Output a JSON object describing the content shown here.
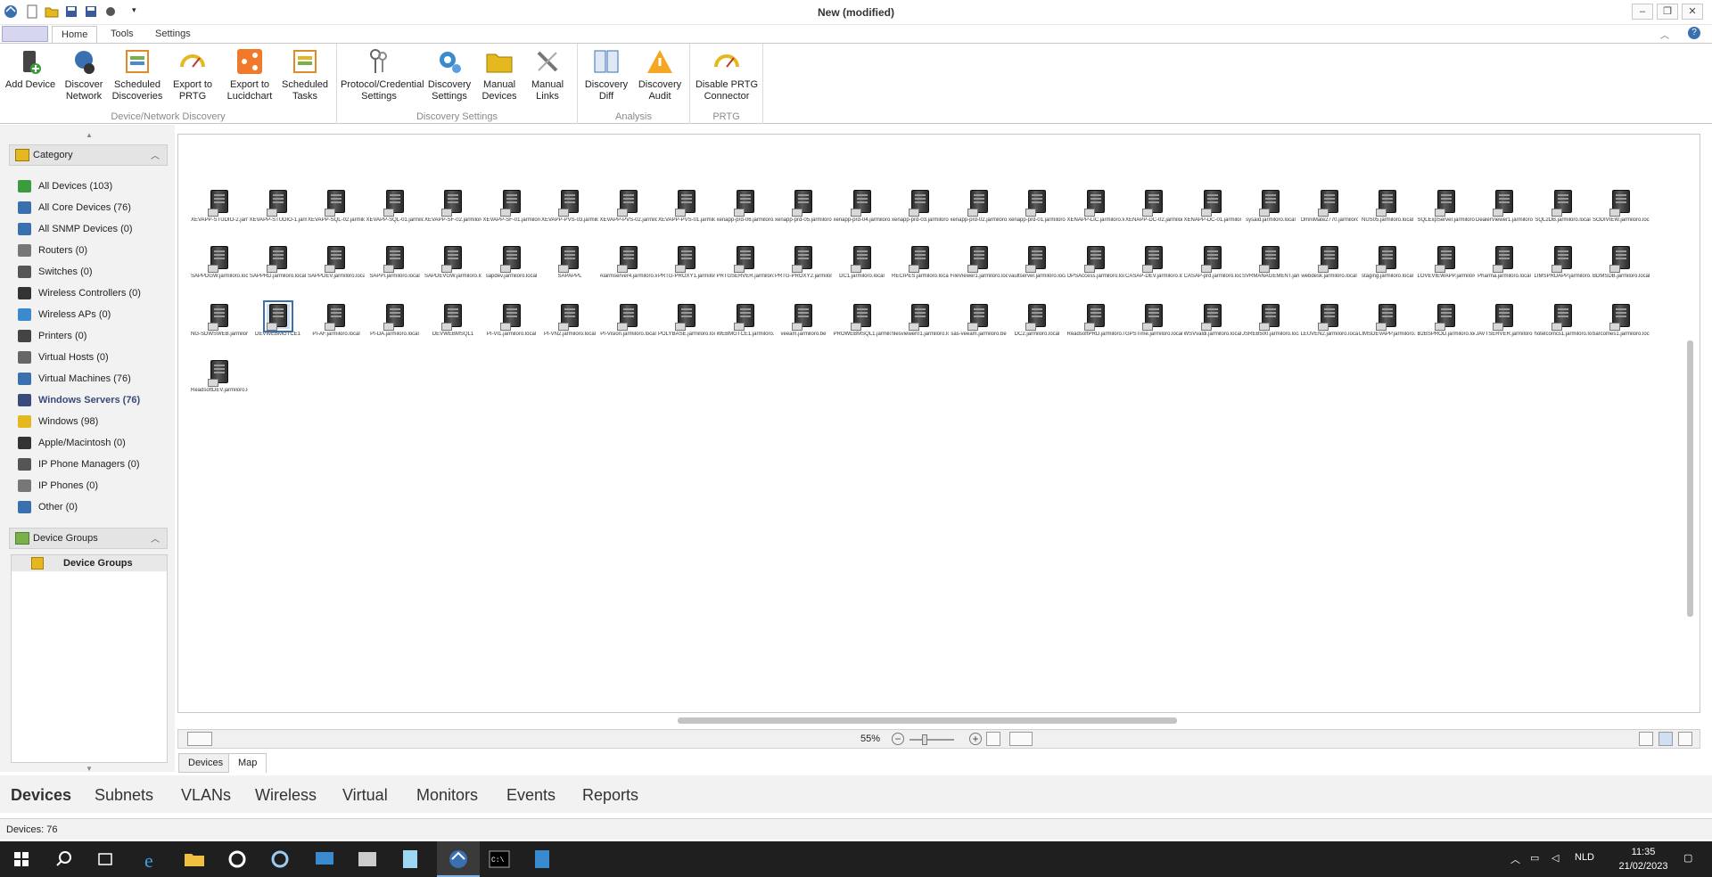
{
  "window": {
    "title": "New (modified)"
  },
  "ribbon_tabs": [
    "Home",
    "Tools",
    "Settings"
  ],
  "ribbon_groups": [
    {
      "label": "Device/Network Discovery",
      "buttons": [
        "Add Device",
        "Discover\nNetwork",
        "Scheduled\nDiscoveries",
        "Export to\nPRTG",
        "Export to\nLucidchart",
        "Scheduled\nTasks"
      ]
    },
    {
      "label": "Discovery Settings",
      "buttons": [
        "Protocol/Credential\nSettings",
        "Discovery\nSettings",
        "Manual\nDevices",
        "Manual\nLinks"
      ]
    },
    {
      "label": "Analysis",
      "buttons": [
        "Discovery\nDiff",
        "Discovery\nAudit"
      ]
    },
    {
      "label": "PRTG",
      "buttons": [
        "Disable PRTG\nConnector"
      ]
    }
  ],
  "category_panel": {
    "title": "Category",
    "items": [
      "All Devices (103)",
      "All Core Devices (76)",
      "All SNMP Devices (0)",
      "Routers (0)",
      "Switches (0)",
      "Wireless Controllers (0)",
      "Wireless APs (0)",
      "Printers (0)",
      "Virtual Hosts (0)",
      "Virtual Machines (76)",
      "Windows Servers (76)",
      "Windows (98)",
      "Apple/Macintosh (0)",
      "IP Phone Managers (0)",
      "IP Phones (0)",
      "Other (0)"
    ],
    "selected": "Windows Servers (76)"
  },
  "device_groups_panel": {
    "title": "Device Groups",
    "root": "Device Groups"
  },
  "map": {
    "rows": [
      [
        "XEVAPP-STUDIO-2.jarmiloro.local",
        "XEVAPP-STUDIO-1.jarmiloro.local",
        "XEVAPP-SQL-02.jarmiloro.local",
        "XEVAPP-SQL-01.jarmiloro.local",
        "XEVAPP-SF-02.jarmiloro.local",
        "XEVAPP-SF-01.jarmiloro.local",
        "XEVAPP-PVS-03.jarmiloro.local",
        "XEVAPP-PVS-02.jarmiloro.local",
        "XEVAPP-PVS-01.jarmiloro.local",
        "xenapp-prd-06.jarmiloro.local",
        "xenapp-prd-05.jarmiloro.local",
        "xenapp-prd-04.jarmiloro.local",
        "xenapp-prd-03.jarmiloro.local",
        "xenapp-prd-02.jarmiloro.local",
        "xenapp-prd-01.jarmiloro.local",
        "XENAPP-LIC.jarmiloro.local",
        "XENAPP-DC-02.jarmiloro.local",
        "XENAPP-DC-01.jarmiloro.local",
        "sysaid.jarmiloro.local",
        "OmniMate2770.jarmiloro.local",
        "NUS05.jarmiloro.local",
        "SQLExpServer.jarmiloro.local",
        "DealerViewer1.jarmiloro.local",
        "SQL2DB.jarmiloro.local",
        "SODIVIEW.jarmiloro.local"
      ],
      [
        "SAPPDGW.jarmiloro.local",
        "SAPPRD.jarmiloro.local",
        "SAPPDEV.jarmiloro.local",
        "SAPPI.jarmiloro.local",
        "SAPDEVGW.jarmiloro.local",
        "sapdev.jarmiloro.local",
        "SAPAPPL",
        "Alarmserver4.jarmiloro.local",
        "PRTG-PROXY1.jarmiloro.local",
        "PRTGSERVER.jarmiloro.local",
        "PRTG-PROXY2.jarmiloro.local",
        "DC1.jarmiloro.local",
        "RECIPES.jarmiloro.local",
        "FileViewer1.jarmiloro.local",
        "vaultserver.jarmiloro.local",
        "OPSAccess.jarmiloro.local",
        "CASAP-DEV.jarmiloro.local",
        "CASAP-prd.jarmiloro.local",
        "SVRMANAGEMENT.jarmiloro.local",
        "webdesk.jarmiloro.local",
        "staging.jarmiloro.local",
        "LOVEVIEWAPP.jarmiloro.local",
        "Pharma.jarmiloro.local",
        "LIMSPRDAPP.jarmiloro.local",
        "BDMSDB.jarmiloro.local"
      ],
      [
        "NG-SDWSWEB.jarmiloro.local",
        "DEVWEBMGTCE1",
        "PI-AF.jarmiloro.local",
        "PI-DA.jarmiloro.local",
        "DEVWEBMSQL1",
        "PI-VI1.jarmiloro.local",
        "PI-VN2.jarmiloro.local",
        "PI-Vision.jarmiloro.local",
        "POLYBASE.jarmiloro.local",
        "WEBMGTCE1.jarmiloro.local",
        "veeam.jarmiloro.be",
        "PROWEBMSQL1.jarmiloro.local",
        "filesviewer01.jarmiloro.local",
        "sas-veeam.jarmiloro.be",
        "DC2.jarmiloro.local",
        "ReadsoftPRD.jarmiloro.local",
        "GPSTime.jarmiloro.local",
        "WSVvaldi.jarmiloro.local",
        "JSREB500.jarmiloro.local",
        "LEUVEN2.jarmiloro.local",
        "LIMSDEVAPP.jarmiloro.local",
        "B2BSPROD.jarmiloro.local",
        "JAVTSERVER.jarmiloro.local",
        "hotelcomcs1.jarmiloro.local",
        "barcomes1.jarmiloro.local"
      ],
      [
        "ReadsoftDEV.jarmiloro.local"
      ]
    ],
    "selected_device": "DEVWEBMGTCE1"
  },
  "map_toolbar": {
    "zoom": "55%"
  },
  "view_tabs": [
    "Devices",
    "Map"
  ],
  "active_view_tab": "Map",
  "bottom_nav": [
    "Devices",
    "Subnets",
    "VLANs",
    "Wireless",
    "Virtual",
    "Monitors",
    "Events",
    "Reports"
  ],
  "status": "Devices: 76",
  "taskbar": {
    "language": "NLD",
    "time": "11:35",
    "date": "21/02/2023"
  },
  "colors": {
    "accent": "#3a4a7a",
    "taskbar": "#1f1f1f",
    "selection": "#3a6fb0"
  }
}
